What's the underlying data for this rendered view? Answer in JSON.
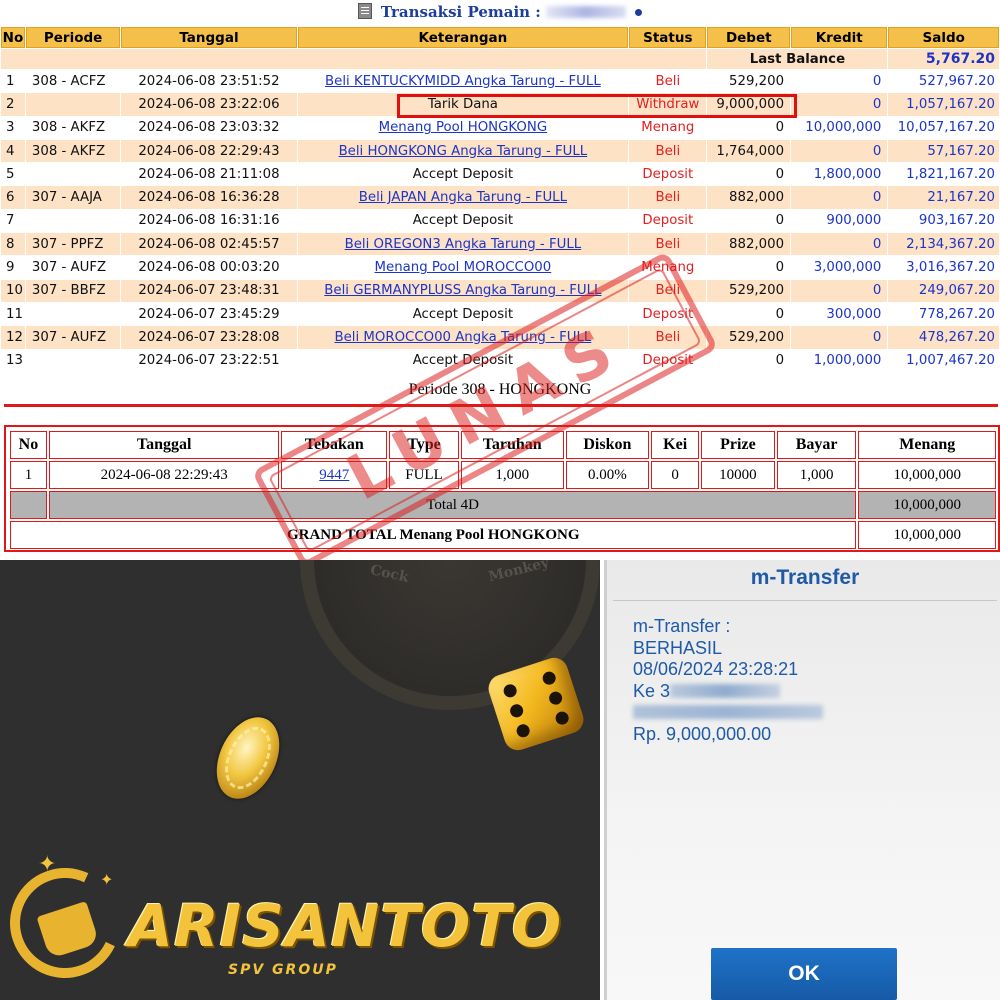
{
  "header": {
    "title": "Transaksi",
    "subtitle": "Pemain :",
    "icon": "document-icon"
  },
  "tx_table": {
    "columns": [
      "No",
      "Periode",
      "Tanggal",
      "Keterangan",
      "Status",
      "Debet",
      "Kredit",
      "Saldo"
    ],
    "last_balance_label": "Last Balance",
    "last_balance_value": "5,767.20",
    "rows": [
      {
        "no": "1",
        "periode": "308 - ACFZ",
        "tanggal": "2024-06-08 23:51:52",
        "keterangan": "Beli KENTUCKYMIDD Angka Tarung - FULL",
        "link": true,
        "status": "Beli",
        "debet": "529,200",
        "kredit": "0",
        "saldo": "527,967.20"
      },
      {
        "no": "2",
        "periode": "",
        "tanggal": "2024-06-08 23:22:06",
        "keterangan": "Tarik Dana",
        "link": false,
        "status": "Withdraw",
        "debet": "9,000,000",
        "kredit": "0",
        "saldo": "1,057,167.20"
      },
      {
        "no": "3",
        "periode": "308 - AKFZ",
        "tanggal": "2024-06-08 23:03:32",
        "keterangan": "Menang Pool HONGKONG",
        "link": true,
        "status": "Menang",
        "debet": "0",
        "kredit": "10,000,000",
        "saldo": "10,057,167.20"
      },
      {
        "no": "4",
        "periode": "308 - AKFZ",
        "tanggal": "2024-06-08 22:29:43",
        "keterangan": "Beli HONGKONG Angka Tarung - FULL",
        "link": true,
        "status": "Beli",
        "debet": "1,764,000",
        "kredit": "0",
        "saldo": "57,167.20"
      },
      {
        "no": "5",
        "periode": "",
        "tanggal": "2024-06-08 21:11:08",
        "keterangan": "Accept Deposit",
        "link": false,
        "status": "Deposit",
        "debet": "0",
        "kredit": "1,800,000",
        "saldo": "1,821,167.20"
      },
      {
        "no": "6",
        "periode": "307 - AAJA",
        "tanggal": "2024-06-08 16:36:28",
        "keterangan": "Beli JAPAN Angka Tarung - FULL",
        "link": true,
        "status": "Beli",
        "debet": "882,000",
        "kredit": "0",
        "saldo": "21,167.20"
      },
      {
        "no": "7",
        "periode": "",
        "tanggal": "2024-06-08 16:31:16",
        "keterangan": "Accept Deposit",
        "link": false,
        "status": "Deposit",
        "debet": "0",
        "kredit": "900,000",
        "saldo": "903,167.20"
      },
      {
        "no": "8",
        "periode": "307 - PPFZ",
        "tanggal": "2024-06-08 02:45:57",
        "keterangan": "Beli OREGON3 Angka Tarung - FULL",
        "link": true,
        "status": "Beli",
        "debet": "882,000",
        "kredit": "0",
        "saldo": "2,134,367.20"
      },
      {
        "no": "9",
        "periode": "307 - AUFZ",
        "tanggal": "2024-06-08 00:03:20",
        "keterangan": "Menang Pool MOROCCO00",
        "link": true,
        "status": "Menang",
        "debet": "0",
        "kredit": "3,000,000",
        "saldo": "3,016,367.20"
      },
      {
        "no": "10",
        "periode": "307 - BBFZ",
        "tanggal": "2024-06-07 23:48:31",
        "keterangan": "Beli GERMANYPLUSS Angka Tarung - FULL",
        "link": true,
        "status": "Beli",
        "debet": "529,200",
        "kredit": "0",
        "saldo": "249,067.20"
      },
      {
        "no": "11",
        "periode": "",
        "tanggal": "2024-06-07 23:45:29",
        "keterangan": "Accept Deposit",
        "link": false,
        "status": "Deposit",
        "debet": "0",
        "kredit": "300,000",
        "saldo": "778,267.20"
      },
      {
        "no": "12",
        "periode": "307 - AUFZ",
        "tanggal": "2024-06-07 23:28:08",
        "keterangan": "Beli MOROCCO00 Angka Tarung - FULL",
        "link": true,
        "status": "Beli",
        "debet": "529,200",
        "kredit": "0",
        "saldo": "478,267.20"
      },
      {
        "no": "13",
        "periode": "",
        "tanggal": "2024-06-07 23:22:51",
        "keterangan": "Accept Deposit",
        "link": false,
        "status": "Deposit",
        "debet": "0",
        "kredit": "1,000,000",
        "saldo": "1,007,467.20"
      }
    ]
  },
  "detail": {
    "caption": "Periode 308 - HONGKONG",
    "columns": [
      "No",
      "Tanggal",
      "Tebakan",
      "Type",
      "Taruhan",
      "Diskon",
      "Kei",
      "Prize",
      "Bayar",
      "Menang"
    ],
    "row": {
      "no": "1",
      "tanggal": "2024-06-08 22:29:43",
      "tebakan": "9447",
      "type": "FULL",
      "taruhan": "1,000",
      "diskon": "0.00%",
      "kei": "0",
      "prize": "10000",
      "bayar": "1,000",
      "menang": "10,000,000"
    },
    "total_label": "Total 4D",
    "total_value": "10,000,000",
    "grand_label": "GRAND TOTAL  Menang Pool HONGKONG",
    "grand_value": "10,000,000",
    "stamp": "LUNAS"
  },
  "promo": {
    "wheel_labels": [
      "Cock",
      "Monkey"
    ],
    "logo_text": "ARISANTOTO",
    "logo_sub": "SPV GROUP"
  },
  "transfer": {
    "title": "m-Transfer",
    "line1": "m-Transfer :",
    "line2": "BERHASIL",
    "line3": "08/06/2024 23:28:21",
    "line4_prefix": "Ke 3",
    "amount": "Rp. 9,000,000.00",
    "ok_label": "OK"
  },
  "colors": {
    "header_bg": "#f5c04a",
    "row_alt": "#fde2c6",
    "link": "#1c34c8",
    "status_red": "#e12020",
    "highlight": "#e01010",
    "panel_dark": "#2f2f2f",
    "gold": "#f3c33c",
    "transfer_blue": "#1e5aa8"
  }
}
